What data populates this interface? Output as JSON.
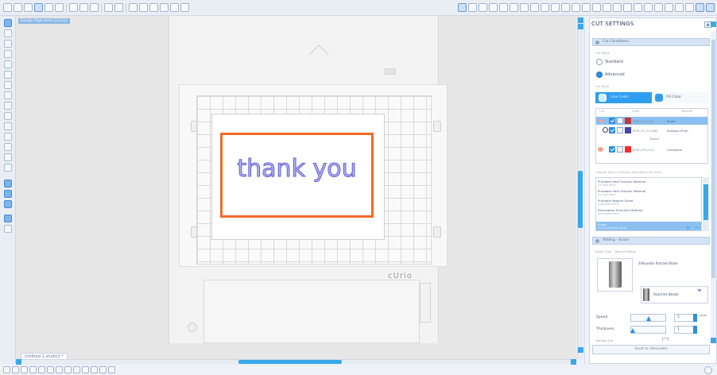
{
  "document": {
    "canvas_label": "Design Page Area (12x12)",
    "tab_name": "Untitled-1.studio3",
    "tab_marker": "*",
    "design_text": "thank you",
    "machine_label": "cUrio"
  },
  "panel": {
    "title": "CUT SETTINGS",
    "close": "▲",
    "cut_conditions": {
      "header": "Cut Conditions",
      "cut_mode_caption": "Cut Mode",
      "option_standard": "Standard",
      "option_advanced": "Advanced",
      "cut_style_caption": "Cut Style",
      "tab_line_color": "Line Color",
      "tab_fill_color": "Fill Color",
      "table_headers": [
        "Cut",
        "Color",
        "Material"
      ],
      "rows": [
        {
          "color_label": "RGB (204,0,0)",
          "material": "Score",
          "swatch": "#c23a3a"
        },
        {
          "color_label": "RGB (70,70,166)",
          "material": "Emboss (Fine)",
          "swatch": "#4646a6"
        },
        {
          "color_label": "RGB (255,0,0)",
          "material": "Cardstock",
          "swatch": "#ff2a2a"
        }
      ],
      "row_group_label": "Speed"
    },
    "materials": {
      "caption": "Choose Type (Currently Selected Line Color)",
      "items": [
        {
          "title": "Printable Heat Transfer Material",
          "sub": "For dark fabric"
        },
        {
          "title": "Printable Heat Transfer Material",
          "sub": "For light fabric"
        },
        {
          "title": "Printable Magnet Sheet",
          "sub": "Silhouette brand"
        },
        {
          "title": "Rhinestone Template Material",
          "sub": "Silhouette brand"
        },
        {
          "title": "Score",
          "sub": "Score & Emboss Stylus"
        }
      ],
      "add": "+",
      "remove": "−"
    },
    "adding": {
      "header": "Adding - Score",
      "blade_caption": "Blade Type - Ratchet Blade",
      "blade_name": "Silhouette Ratchet Blade",
      "selected_tool": "Ratchet Blade"
    },
    "speed": {
      "label": "Speed",
      "value": "5",
      "unit": "cm/s"
    },
    "thickness": {
      "label": "Thickness",
      "value": "1"
    },
    "double_cut_label": "Double Cut",
    "send_button": "Send to Silhouette"
  },
  "colors": {
    "accent": "#2f9ef0",
    "cut_line": "#f06a2c",
    "text_stroke": "#5f5fd8"
  }
}
